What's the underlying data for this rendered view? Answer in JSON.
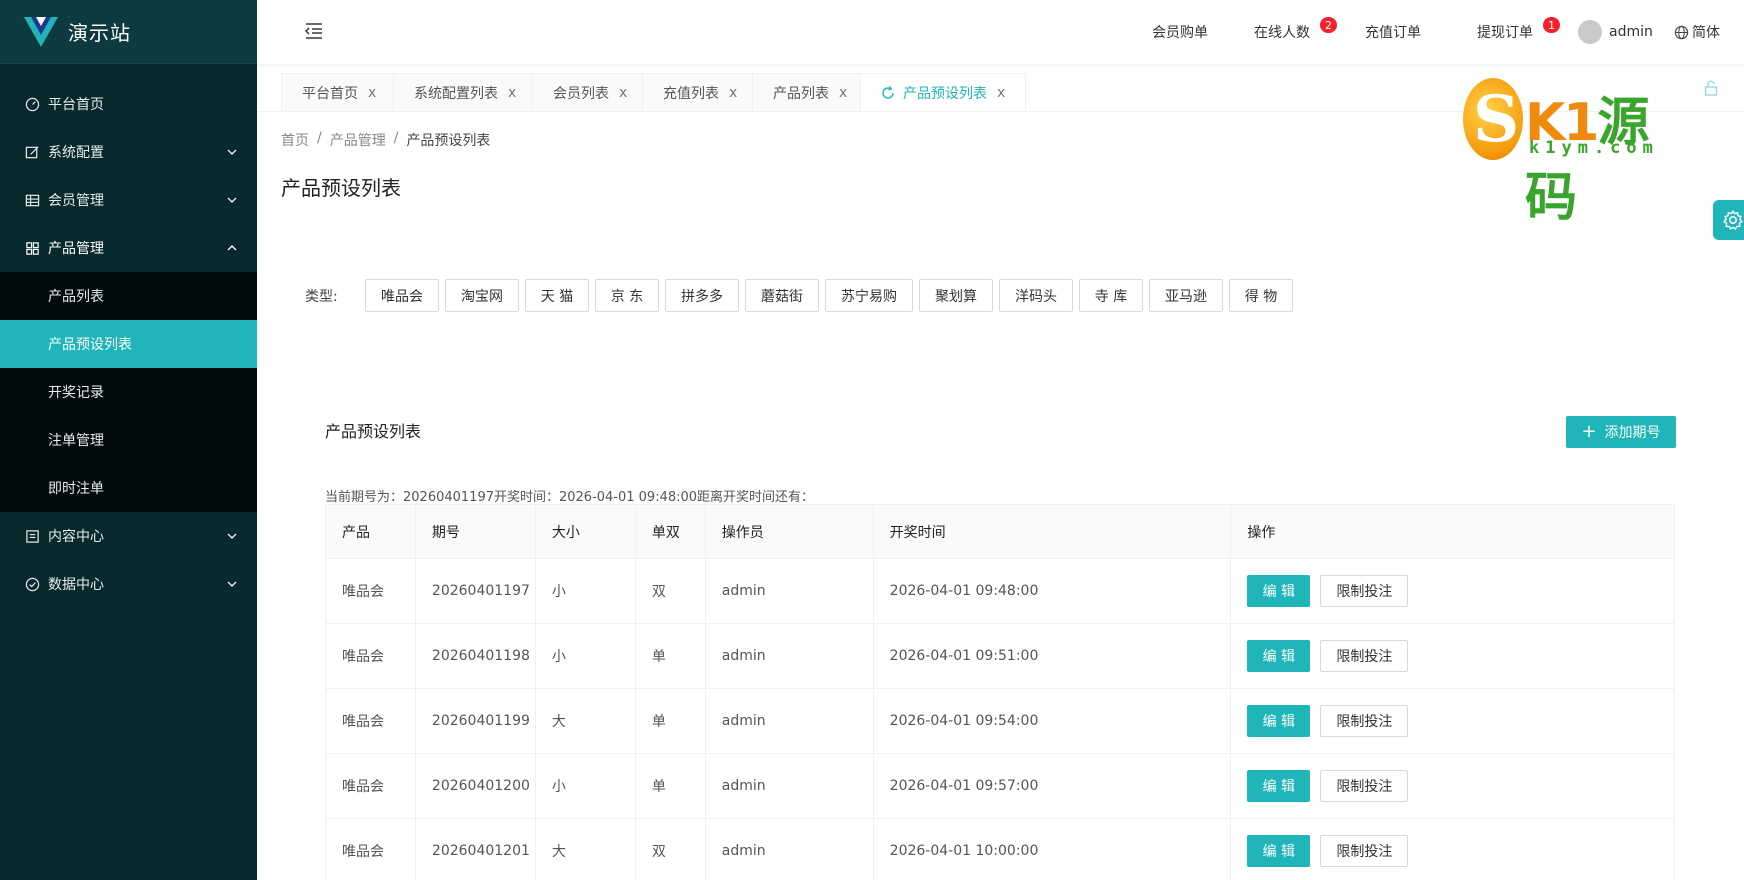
{
  "brand": {
    "title": "演示站",
    "logo_color": "#1fb5b9",
    "logo_dark": "#1e3a8a"
  },
  "sidebar": {
    "items": [
      {
        "label": "平台首页",
        "icon": "dashboard-icon"
      },
      {
        "label": "系统配置",
        "icon": "edit-icon",
        "arrow": "chevron-down-icon"
      },
      {
        "label": "会员管理",
        "icon": "table-icon",
        "arrow": "chevron-down-icon"
      },
      {
        "label": "产品管理",
        "icon": "appstore-icon",
        "arrow": "chevron-up-icon"
      },
      {
        "label": "内容中心",
        "icon": "profile-icon",
        "arrow": "chevron-down-icon"
      },
      {
        "label": "数据中心",
        "icon": "check-circle-icon",
        "arrow": "chevron-down-icon"
      }
    ],
    "product_sub": [
      {
        "label": "产品列表"
      },
      {
        "label": "产品预设列表",
        "active": true
      },
      {
        "label": "开奖记录"
      },
      {
        "label": "注单管理"
      },
      {
        "label": "即时注单"
      }
    ]
  },
  "header": {
    "nav": [
      {
        "label": "会员购单"
      },
      {
        "label": "在线人数",
        "badge": "2"
      },
      {
        "label": "充值订单"
      },
      {
        "label": "提现订单",
        "badge": "1"
      }
    ],
    "user": "admin",
    "lang": "简体"
  },
  "tabs": [
    {
      "label": "平台首页"
    },
    {
      "label": "系统配置列表"
    },
    {
      "label": "会员列表"
    },
    {
      "label": "充值列表"
    },
    {
      "label": "产品列表"
    },
    {
      "label": "产品预设列表",
      "active": true
    }
  ],
  "tab_close": "x",
  "watermark": {
    "text_a": "K1",
    "text_b": "源码",
    "url": "k1ym.com"
  },
  "breadcrumb": {
    "items": [
      "首页",
      "产品管理",
      "产品预设列表"
    ],
    "sep": "/"
  },
  "page_title": "产品预设列表",
  "filter": {
    "label": "类型:",
    "types": [
      "唯品会",
      "淘宝网",
      "天 猫",
      "京 东",
      "拼多多",
      "蘑菇街",
      "苏宁易购",
      "聚划算",
      "洋码头",
      "寺 库",
      "亚马逊",
      "得 物"
    ]
  },
  "card": {
    "title": "产品预设列表",
    "add_label": "添加期号",
    "period_info": "当前期号为：20260401197开奖时间：2026-04-01 09:48:00距离开奖时间还有："
  },
  "table": {
    "columns": [
      "产品",
      "期号",
      "大小",
      "单双",
      "操作员",
      "开奖时间",
      "操作"
    ],
    "rows": [
      [
        "唯品会",
        "20260401197",
        "小",
        "双",
        "admin",
        "2026-04-01 09:48:00"
      ],
      [
        "唯品会",
        "20260401198",
        "小",
        "单",
        "admin",
        "2026-04-01 09:51:00"
      ],
      [
        "唯品会",
        "20260401199",
        "大",
        "单",
        "admin",
        "2026-04-01 09:54:00"
      ],
      [
        "唯品会",
        "20260401200",
        "小",
        "单",
        "admin",
        "2026-04-01 09:57:00"
      ],
      [
        "唯品会",
        "20260401201",
        "大",
        "双",
        "admin",
        "2026-04-01 10:00:00"
      ]
    ],
    "edit_label": "编 辑",
    "limit_label": "限制投注"
  },
  "colors": {
    "accent": "#1fb5b9",
    "sidebar_bg": "#07282d",
    "badge": "#f5222d"
  }
}
